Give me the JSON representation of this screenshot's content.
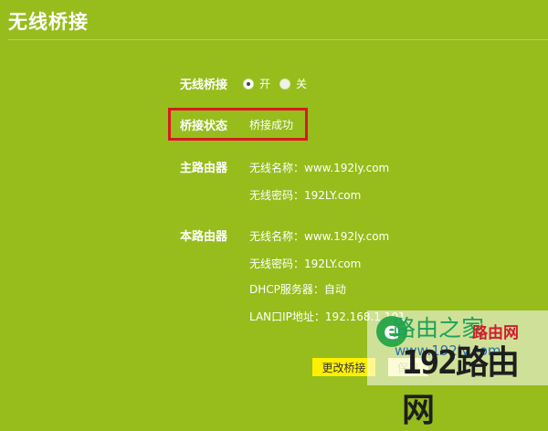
{
  "header": {
    "title": "无线桥接"
  },
  "bridge": {
    "label": "无线桥接",
    "options": [
      {
        "label": "开",
        "checked": true
      },
      {
        "label": "关",
        "checked": false
      }
    ]
  },
  "status": {
    "label": "桥接状态",
    "value": "桥接成功"
  },
  "main_router": {
    "label": "主路由器",
    "ssid": "无线名称：www.192ly.com",
    "password": "无线密码：192LY.com"
  },
  "this_router": {
    "label": "本路由器",
    "ssid": "无线名称：www.192ly.com",
    "password": "无线密码：192LY.com",
    "dhcp": "DHCP服务器：自动",
    "lan_ip": "LAN口IP地址：192.168.1.101"
  },
  "buttons": {
    "change_label": "更改桥接",
    "save_label": "保存"
  },
  "watermark": {
    "logo_char": "e",
    "name": "路由之家",
    "site": "路由网",
    "big": "192路由网",
    "url": "www.192ly.com"
  },
  "colors": {
    "background": "#96bd1c",
    "highlight_border": "#d71920",
    "primary_button": "#fff000"
  }
}
